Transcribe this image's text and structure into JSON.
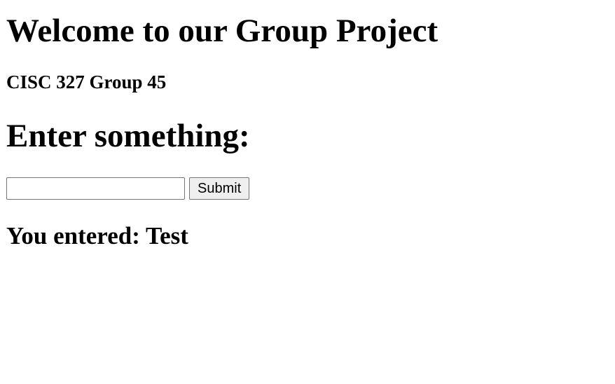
{
  "page": {
    "title": "Welcome to our Group Project",
    "subtitle": "CISC 327 Group 45",
    "prompt_heading": "Enter something:"
  },
  "form": {
    "input_value": "",
    "input_placeholder": "",
    "submit_label": "Submit"
  },
  "result": {
    "text": "You entered: Test"
  }
}
